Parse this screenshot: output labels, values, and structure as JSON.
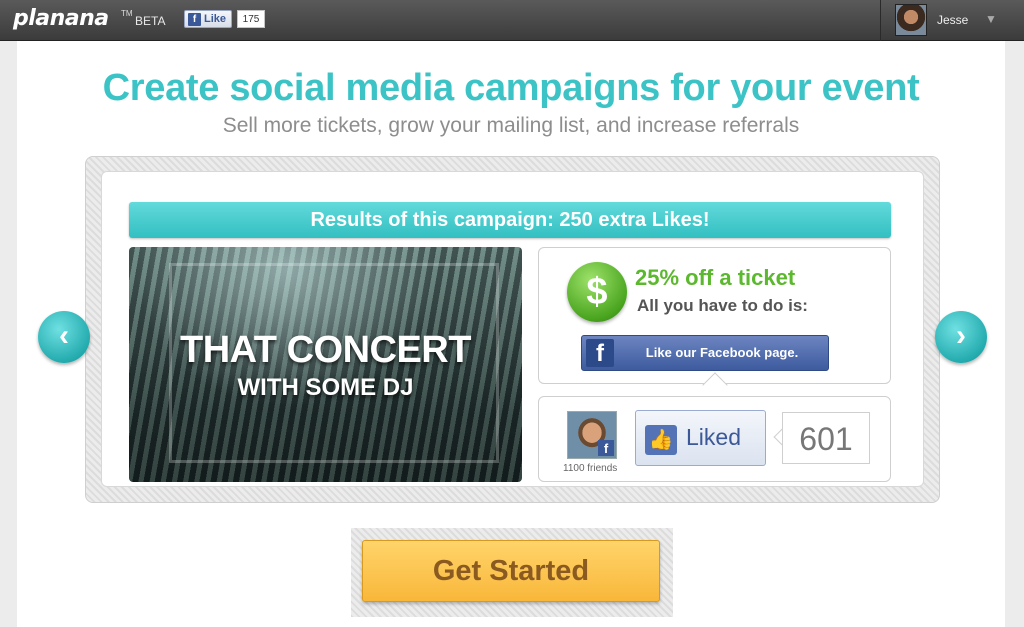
{
  "header": {
    "logo": "planana",
    "tm": "TM",
    "beta": "BETA",
    "fb_like_label": "Like",
    "fb_like_count": "175",
    "user_name": "Jesse"
  },
  "hero": {
    "title": "Create social media campaigns for your event",
    "subtitle": "Sell more tickets, grow your mailing list, and increase referrals"
  },
  "campaign": {
    "results": "Results of this campaign: 250 extra Likes!",
    "event_title": "THAT CONCERT",
    "event_subtitle": "WITH SOME DJ",
    "offer_title": "25% off a ticket",
    "offer_sub": "All you have to do is:",
    "fb_button_label": "Like our Facebook page.",
    "friends_count": "1100 friends",
    "liked_label": "Liked",
    "like_count": "601"
  },
  "cta": {
    "label": "Get Started"
  },
  "colors": {
    "accent": "#3cc3c6",
    "offer_green": "#5cb82e",
    "cta_yellow": "#f9b73a",
    "facebook_blue": "#3b5998"
  },
  "icons": {
    "prev": "chevron-left-icon",
    "next": "chevron-right-icon",
    "dollar": "dollar-icon",
    "thumbs_up": "thumbs-up-icon",
    "facebook": "facebook-icon"
  }
}
